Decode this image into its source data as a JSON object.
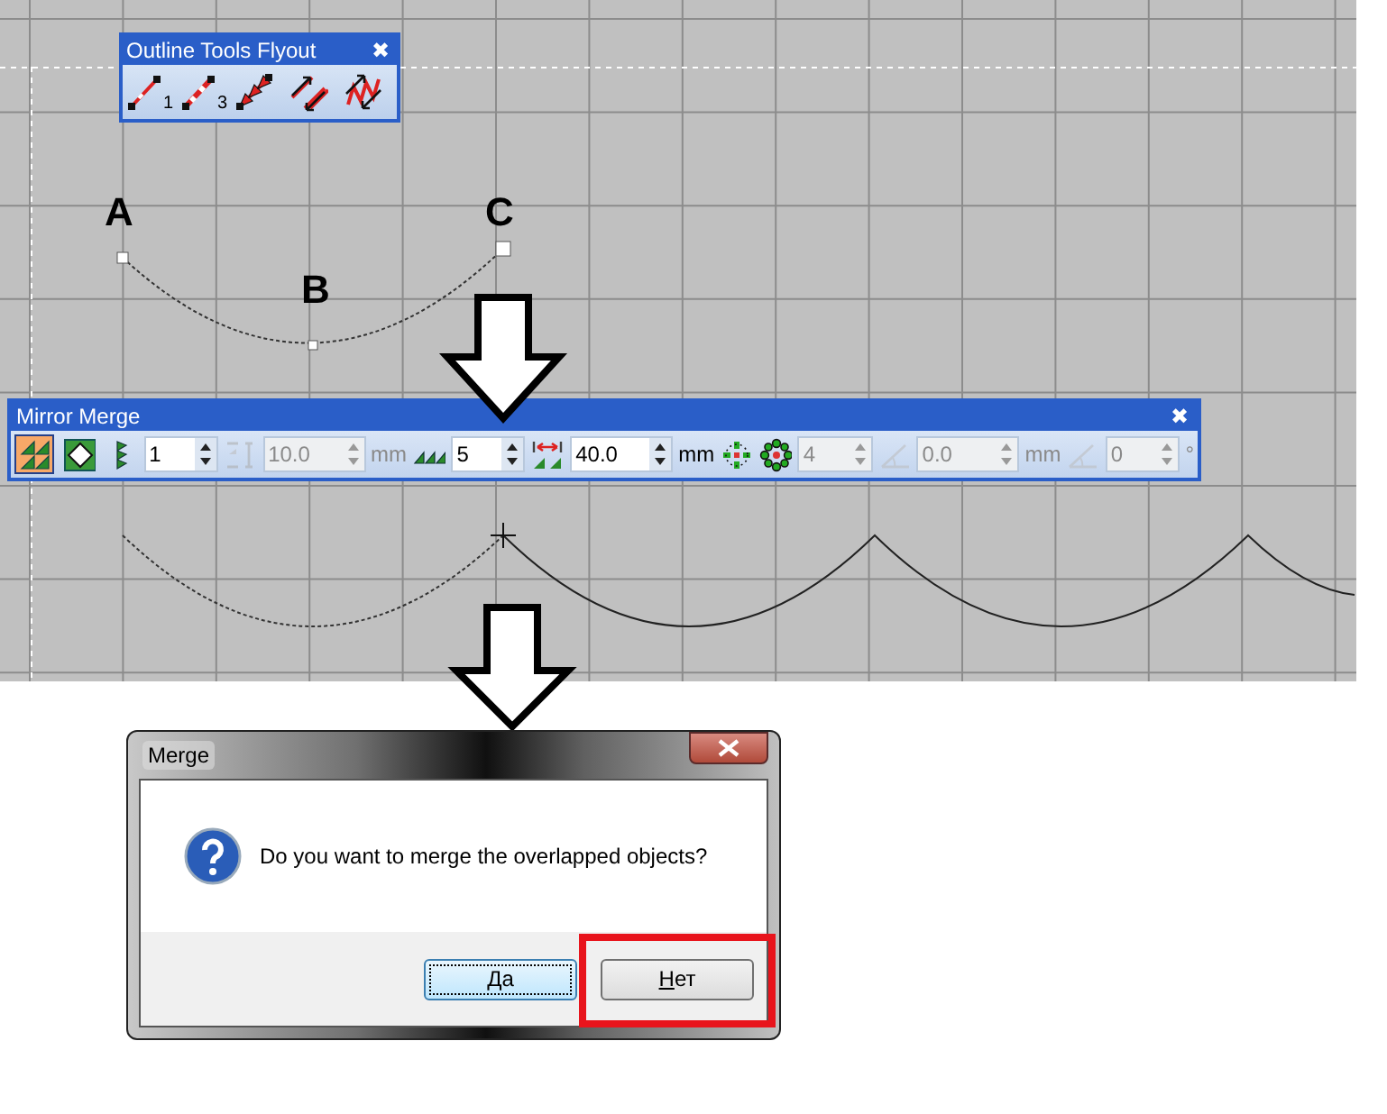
{
  "flyout": {
    "title": "Outline Tools Flyout",
    "close": "✖",
    "tool_numbers": [
      "1",
      "3"
    ]
  },
  "points": [
    {
      "label": "A"
    },
    {
      "label": "B"
    },
    {
      "label": "C"
    }
  ],
  "toolbar": {
    "title": "Mirror Merge",
    "close": "✖",
    "items": [
      {
        "kind": "toggle",
        "selected": true
      },
      {
        "kind": "toggle",
        "selected": false
      },
      {
        "kind": "tool",
        "disabled": false
      },
      {
        "kind": "spin",
        "value": "1",
        "disabled": false
      },
      {
        "kind": "tool",
        "disabled": true
      },
      {
        "kind": "spin",
        "value": "10.0",
        "disabled": true
      },
      {
        "kind": "unit",
        "text": "mm",
        "disabled": true
      },
      {
        "kind": "tool",
        "disabled": false
      },
      {
        "kind": "spin",
        "value": "5",
        "disabled": false
      },
      {
        "kind": "tool",
        "disabled": false
      },
      {
        "kind": "spin",
        "value": "40.0",
        "disabled": false
      },
      {
        "kind": "unit",
        "text": "mm",
        "disabled": false
      },
      {
        "kind": "tool",
        "disabled": false
      },
      {
        "kind": "tool",
        "disabled": false
      },
      {
        "kind": "spin",
        "value": "4",
        "disabled": true
      },
      {
        "kind": "tool",
        "disabled": true
      },
      {
        "kind": "spin",
        "value": "0.0",
        "disabled": true
      },
      {
        "kind": "unit",
        "text": "mm",
        "disabled": true
      },
      {
        "kind": "tool",
        "disabled": true
      },
      {
        "kind": "spin",
        "value": "0",
        "disabled": true
      },
      {
        "kind": "unit",
        "text": "°",
        "disabled": true
      }
    ]
  },
  "dialog": {
    "title": "Merge",
    "message": "Do you want to merge the overlapped objects?",
    "buttons": [
      {
        "label": "Да",
        "focused": true,
        "highlighted": false
      },
      {
        "label": "Нет",
        "focused": false,
        "highlighted": true
      }
    ]
  }
}
